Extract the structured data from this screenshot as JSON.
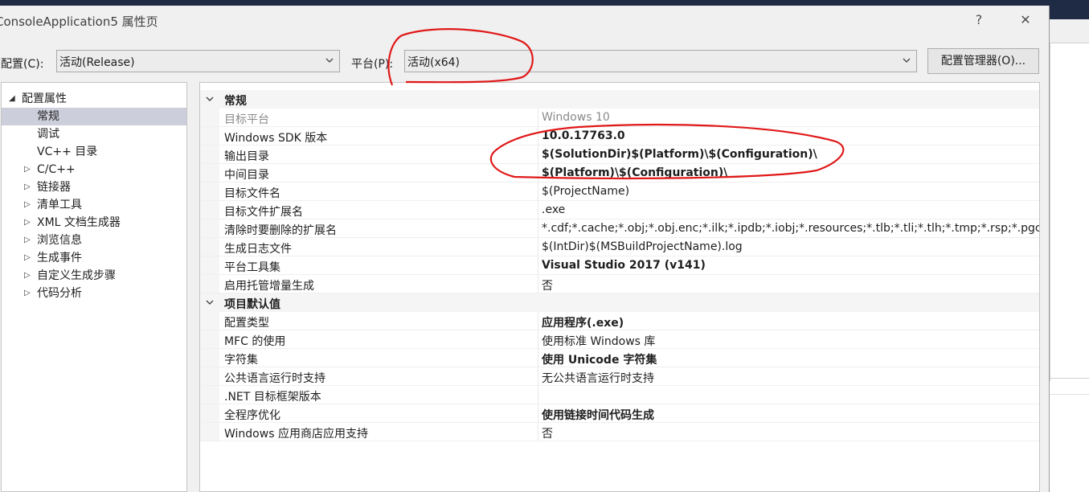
{
  "window": {
    "title": "ConsoleApplication5 属性页",
    "help_label": "?",
    "close_label": "✕"
  },
  "toolbar": {
    "config_label": "配置(C):",
    "config_value": "活动(Release)",
    "platform_label": "平台(P):",
    "platform_value": "活动(x64)",
    "config_manager_label": "配置管理器(O)..."
  },
  "tree": {
    "items": [
      {
        "label": "配置属性",
        "arrow": "◢",
        "level": 0
      },
      {
        "label": "常规",
        "arrow": "",
        "level": 1,
        "selected": true
      },
      {
        "label": "调试",
        "arrow": "",
        "level": 1
      },
      {
        "label": "VC++ 目录",
        "arrow": "",
        "level": 1
      },
      {
        "label": "C/C++",
        "arrow": "▷",
        "level": 1
      },
      {
        "label": "链接器",
        "arrow": "▷",
        "level": 1
      },
      {
        "label": "清单工具",
        "arrow": "▷",
        "level": 1
      },
      {
        "label": "XML 文档生成器",
        "arrow": "▷",
        "level": 1
      },
      {
        "label": "浏览信息",
        "arrow": "▷",
        "level": 1
      },
      {
        "label": "生成事件",
        "arrow": "▷",
        "level": 1
      },
      {
        "label": "自定义生成步骤",
        "arrow": "▷",
        "level": 1
      },
      {
        "label": "代码分析",
        "arrow": "▷",
        "level": 1
      }
    ]
  },
  "grid": {
    "categories": [
      {
        "name": "常规",
        "rows": [
          {
            "name": "目标平台",
            "value": "Windows 10",
            "gray": true
          },
          {
            "name": "Windows SDK 版本",
            "value": "10.0.17763.0",
            "bold": true
          },
          {
            "name": "输出目录",
            "value": "$(SolutionDir)$(Platform)\\$(Configuration)\\",
            "bold": true
          },
          {
            "name": "中间目录",
            "value": "$(Platform)\\$(Configuration)\\",
            "bold": true
          },
          {
            "name": "目标文件名",
            "value": "$(ProjectName)"
          },
          {
            "name": "目标文件扩展名",
            "value": ".exe"
          },
          {
            "name": "清除时要删除的扩展名",
            "value": "*.cdf;*.cache;*.obj;*.obj.enc;*.ilk;*.ipdb;*.iobj;*.resources;*.tlb;*.tli;*.tlh;*.tmp;*.rsp;*.pgc"
          },
          {
            "name": "生成日志文件",
            "value": "$(IntDir)$(MSBuildProjectName).log"
          },
          {
            "name": "平台工具集",
            "value": "Visual Studio 2017 (v141)",
            "bold": true
          },
          {
            "name": "启用托管增量生成",
            "value": "否"
          }
        ]
      },
      {
        "name": "项目默认值",
        "rows": [
          {
            "name": "配置类型",
            "value": "应用程序(.exe)",
            "bold": true
          },
          {
            "name": "MFC 的使用",
            "value": "使用标准 Windows 库"
          },
          {
            "name": "字符集",
            "value": "使用 Unicode 字符集",
            "bold": true
          },
          {
            "name": "公共语言运行时支持",
            "value": "无公共语言运行时支持"
          },
          {
            "name": ".NET 目标框架版本",
            "value": ""
          },
          {
            "name": "全程序优化",
            "value": "使用链接时间代码生成",
            "bold": true
          },
          {
            "name": "Windows 应用商店应用支持",
            "value": "否"
          }
        ]
      }
    ]
  },
  "colors": {
    "annotation": "#e01818",
    "selection": "#cccedb",
    "frame_dark": "#1f2a44"
  }
}
